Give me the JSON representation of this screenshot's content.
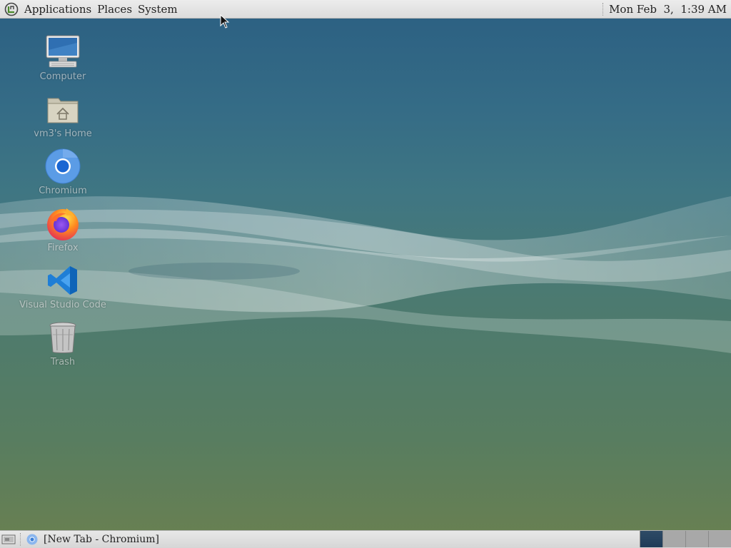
{
  "top_panel": {
    "menus": [
      {
        "label": "Applications"
      },
      {
        "label": "Places"
      },
      {
        "label": "System"
      }
    ],
    "clock": "Mon Feb  3,  1:39 AM"
  },
  "desktop_icons": [
    {
      "label": "Computer",
      "icon": "computer-icon"
    },
    {
      "label": "vm3's Home",
      "icon": "home-folder-icon"
    },
    {
      "label": "Chromium",
      "icon": "chromium-icon"
    },
    {
      "label": "Firefox",
      "icon": "firefox-icon"
    },
    {
      "label": "Visual Studio Code",
      "icon": "vscode-icon"
    },
    {
      "label": "Trash",
      "icon": "trash-icon"
    }
  ],
  "bottom_panel": {
    "tasks": [
      {
        "label": "[New Tab - Chromium]",
        "icon": "chromium-icon"
      }
    ],
    "workspaces": [
      {
        "active": true
      },
      {
        "active": false
      },
      {
        "active": false
      },
      {
        "active": false
      }
    ]
  },
  "colors": {
    "panel": "#dcdcdc",
    "wallpaper_top": "#2b5f82",
    "wallpaper_bottom": "#6a8050",
    "active_workspace": "#1f3b58"
  }
}
